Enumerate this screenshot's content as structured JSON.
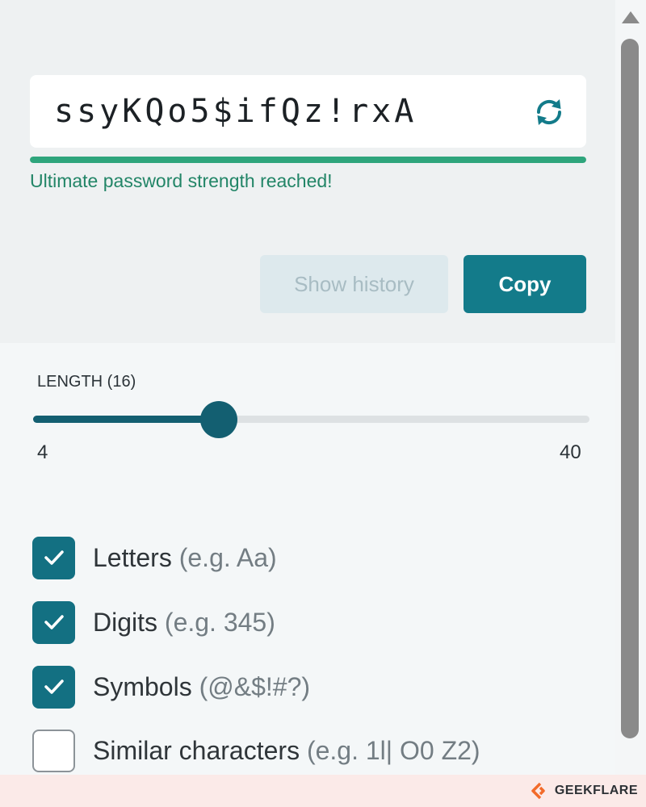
{
  "password": {
    "value": "ssyKQo5$ifQz!rxA",
    "strength_fraction": 1.0,
    "strength_message": "Ultimate password strength reached!"
  },
  "actions": {
    "history_label": "Show history",
    "copy_label": "Copy"
  },
  "length": {
    "label": "LENGTH (16)",
    "value": 16,
    "min": 4,
    "max": 40,
    "min_label": "4",
    "max_label": "40"
  },
  "options": [
    {
      "label": "Letters",
      "hint": "(e.g. Aa)",
      "checked": true
    },
    {
      "label": "Digits",
      "hint": "(e.g. 345)",
      "checked": true
    },
    {
      "label": "Symbols",
      "hint": "(@&$!#?)",
      "checked": true
    },
    {
      "label": "Similar characters",
      "hint": "(e.g. 1l| O0 Z2)",
      "checked": false
    }
  ],
  "footer": {
    "brand": "GEEKFLARE"
  },
  "colors": {
    "accent": "#137b8a",
    "strength": "#2ea57c",
    "slider": "#135f71"
  }
}
